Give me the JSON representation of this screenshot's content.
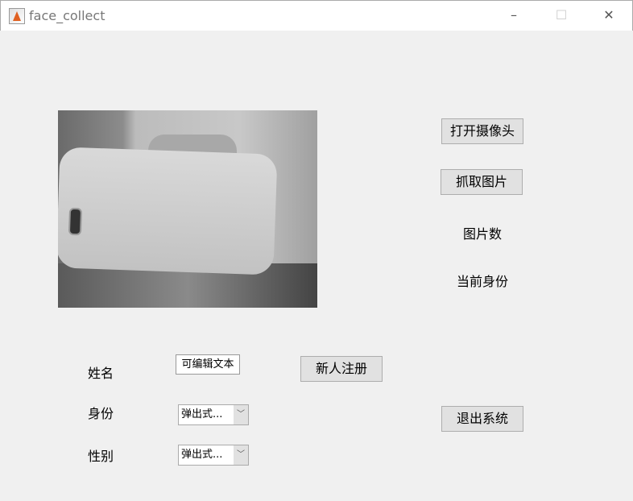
{
  "window": {
    "title": "face_collect",
    "minimize": "–",
    "maximize": "☐",
    "close": "✕"
  },
  "buttons": {
    "open_camera": "打开摄像头",
    "capture": "抓取图片",
    "register": "新人注册",
    "exit": "退出系统"
  },
  "labels": {
    "image_count": "图片数",
    "current_identity": "当前身份",
    "name": "姓名",
    "identity": "身份",
    "gender": "性别"
  },
  "fields": {
    "name_value": "可编辑文本",
    "identity_value": "弹出式...",
    "gender_value": "弹出式..."
  },
  "icons": {
    "dropdown": "chevron-down-icon"
  }
}
